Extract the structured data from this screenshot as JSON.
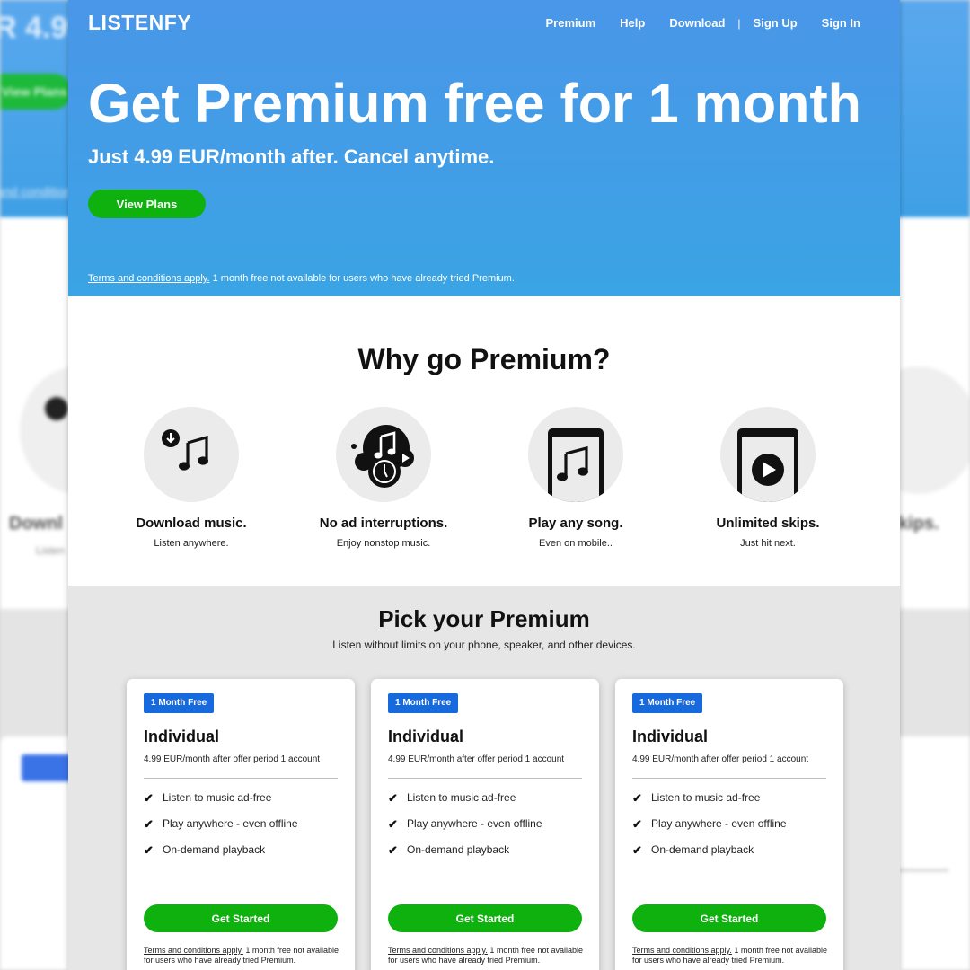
{
  "colors": {
    "hero_blue": "#4a96e8",
    "green": "#0fb10f",
    "badge_blue": "#1769de",
    "section_gray": "#e6e6e6"
  },
  "background": {
    "price_fragment": "R 4.99",
    "plans_fragment": "View Plans",
    "terms_fragment": "and conditions",
    "download_fragment": "Downl",
    "listen_fragment": "Listen",
    "skips_fragment": "kips."
  },
  "header": {
    "logo": "LISTENFY",
    "nav": [
      "Premium",
      "Help",
      "Download",
      "Sign Up",
      "Sign In"
    ],
    "separator": "|"
  },
  "hero": {
    "title": "Get Premium free for 1 month",
    "subtitle": "Just 4.99 EUR/month after. Cancel anytime.",
    "cta": "View Plans",
    "terms_link": "Terms and conditions apply.",
    "terms_text": " 1 month free not available for users who have already tried Premium."
  },
  "why": {
    "title": "Why go Premium?",
    "features": [
      {
        "icon": "download-music-icon",
        "title": "Download music.",
        "subtitle": "Listen anywhere."
      },
      {
        "icon": "no-ads-icon",
        "title": "No ad interruptions.",
        "subtitle": "Enjoy nonstop music."
      },
      {
        "icon": "phone-music-icon",
        "title": "Play any song.",
        "subtitle": "Even on mobile.."
      },
      {
        "icon": "phone-play-icon",
        "title": "Unlimited skips.",
        "subtitle": "Just hit next."
      }
    ]
  },
  "pick": {
    "title": "Pick your Premium",
    "subtitle": "Listen without limits on your phone, speaker, and other devices.",
    "plans": [
      {
        "badge": "1 Month Free",
        "name": "Individual",
        "price": "4.99 EUR/month after offer period 1 account",
        "features": [
          "Listen to music ad-free",
          "Play anywhere - even offline",
          "On-demand playback"
        ],
        "cta": "Get Started",
        "terms_link": "Terms and conditions apply.",
        "terms_text": " 1 month free not available for users who have already tried Premium."
      },
      {
        "badge": "1 Month Free",
        "name": "Individual",
        "price": "4.99 EUR/month after offer period 1 account",
        "features": [
          "Listen to music ad-free",
          "Play anywhere - even offline",
          "On-demand playback"
        ],
        "cta": "Get Started",
        "terms_link": "Terms and conditions apply.",
        "terms_text": " 1 month free not available for users who have already tried Premium."
      },
      {
        "badge": "1 Month Free",
        "name": "Individual",
        "price": "4.99 EUR/month after offer period 1 account",
        "features": [
          "Listen to music ad-free",
          "Play anywhere - even offline",
          "On-demand playback"
        ],
        "cta": "Get Started",
        "terms_link": "Terms and conditions apply.",
        "terms_text": " 1 month free not available for users who have already tried Premium."
      }
    ]
  }
}
